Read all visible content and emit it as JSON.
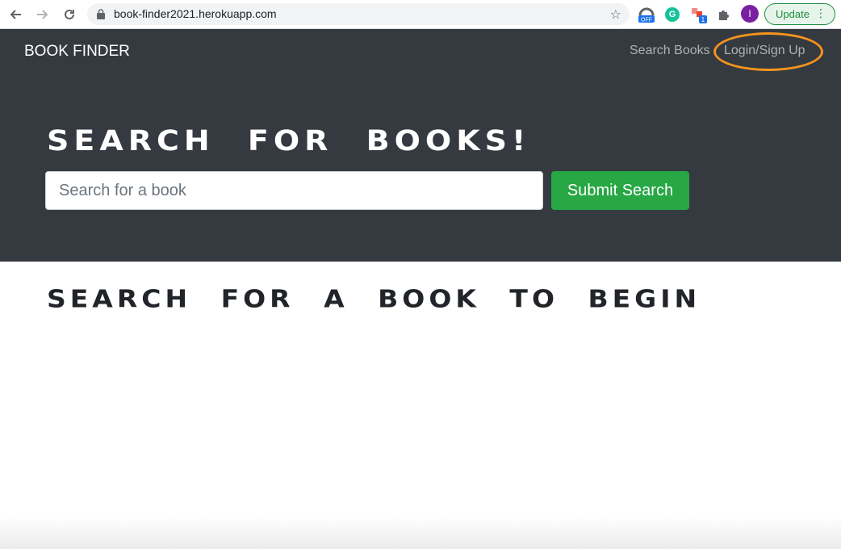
{
  "browser": {
    "url": "book-finder2021.herokuapp.com",
    "back_icon": "←",
    "forward_icon": "→",
    "reload_icon": "↻",
    "star_icon": "☆",
    "extensions": [
      {
        "name": "speedometer-off-icon",
        "badge": "OFF"
      },
      {
        "name": "grammarly-icon",
        "glyph": "G"
      },
      {
        "name": "extension-badge-icon",
        "badge": "1"
      },
      {
        "name": "puzzle-icon"
      }
    ],
    "profile_initial": "I",
    "update_label": "Update",
    "menu_icon": "⋮"
  },
  "navbar": {
    "brand": "BOOK FINDER",
    "links": [
      "Search Books",
      "Login/Sign Up"
    ],
    "highlight_color": "#f7941d"
  },
  "hero": {
    "title": "SEARCH FOR BOOKS!",
    "search_placeholder": "Search for a book",
    "submit_label": "Submit Search",
    "bg_color": "#343a40",
    "button_color": "#28a745"
  },
  "main": {
    "empty_message": "SEARCH FOR A BOOK TO BEGIN"
  }
}
